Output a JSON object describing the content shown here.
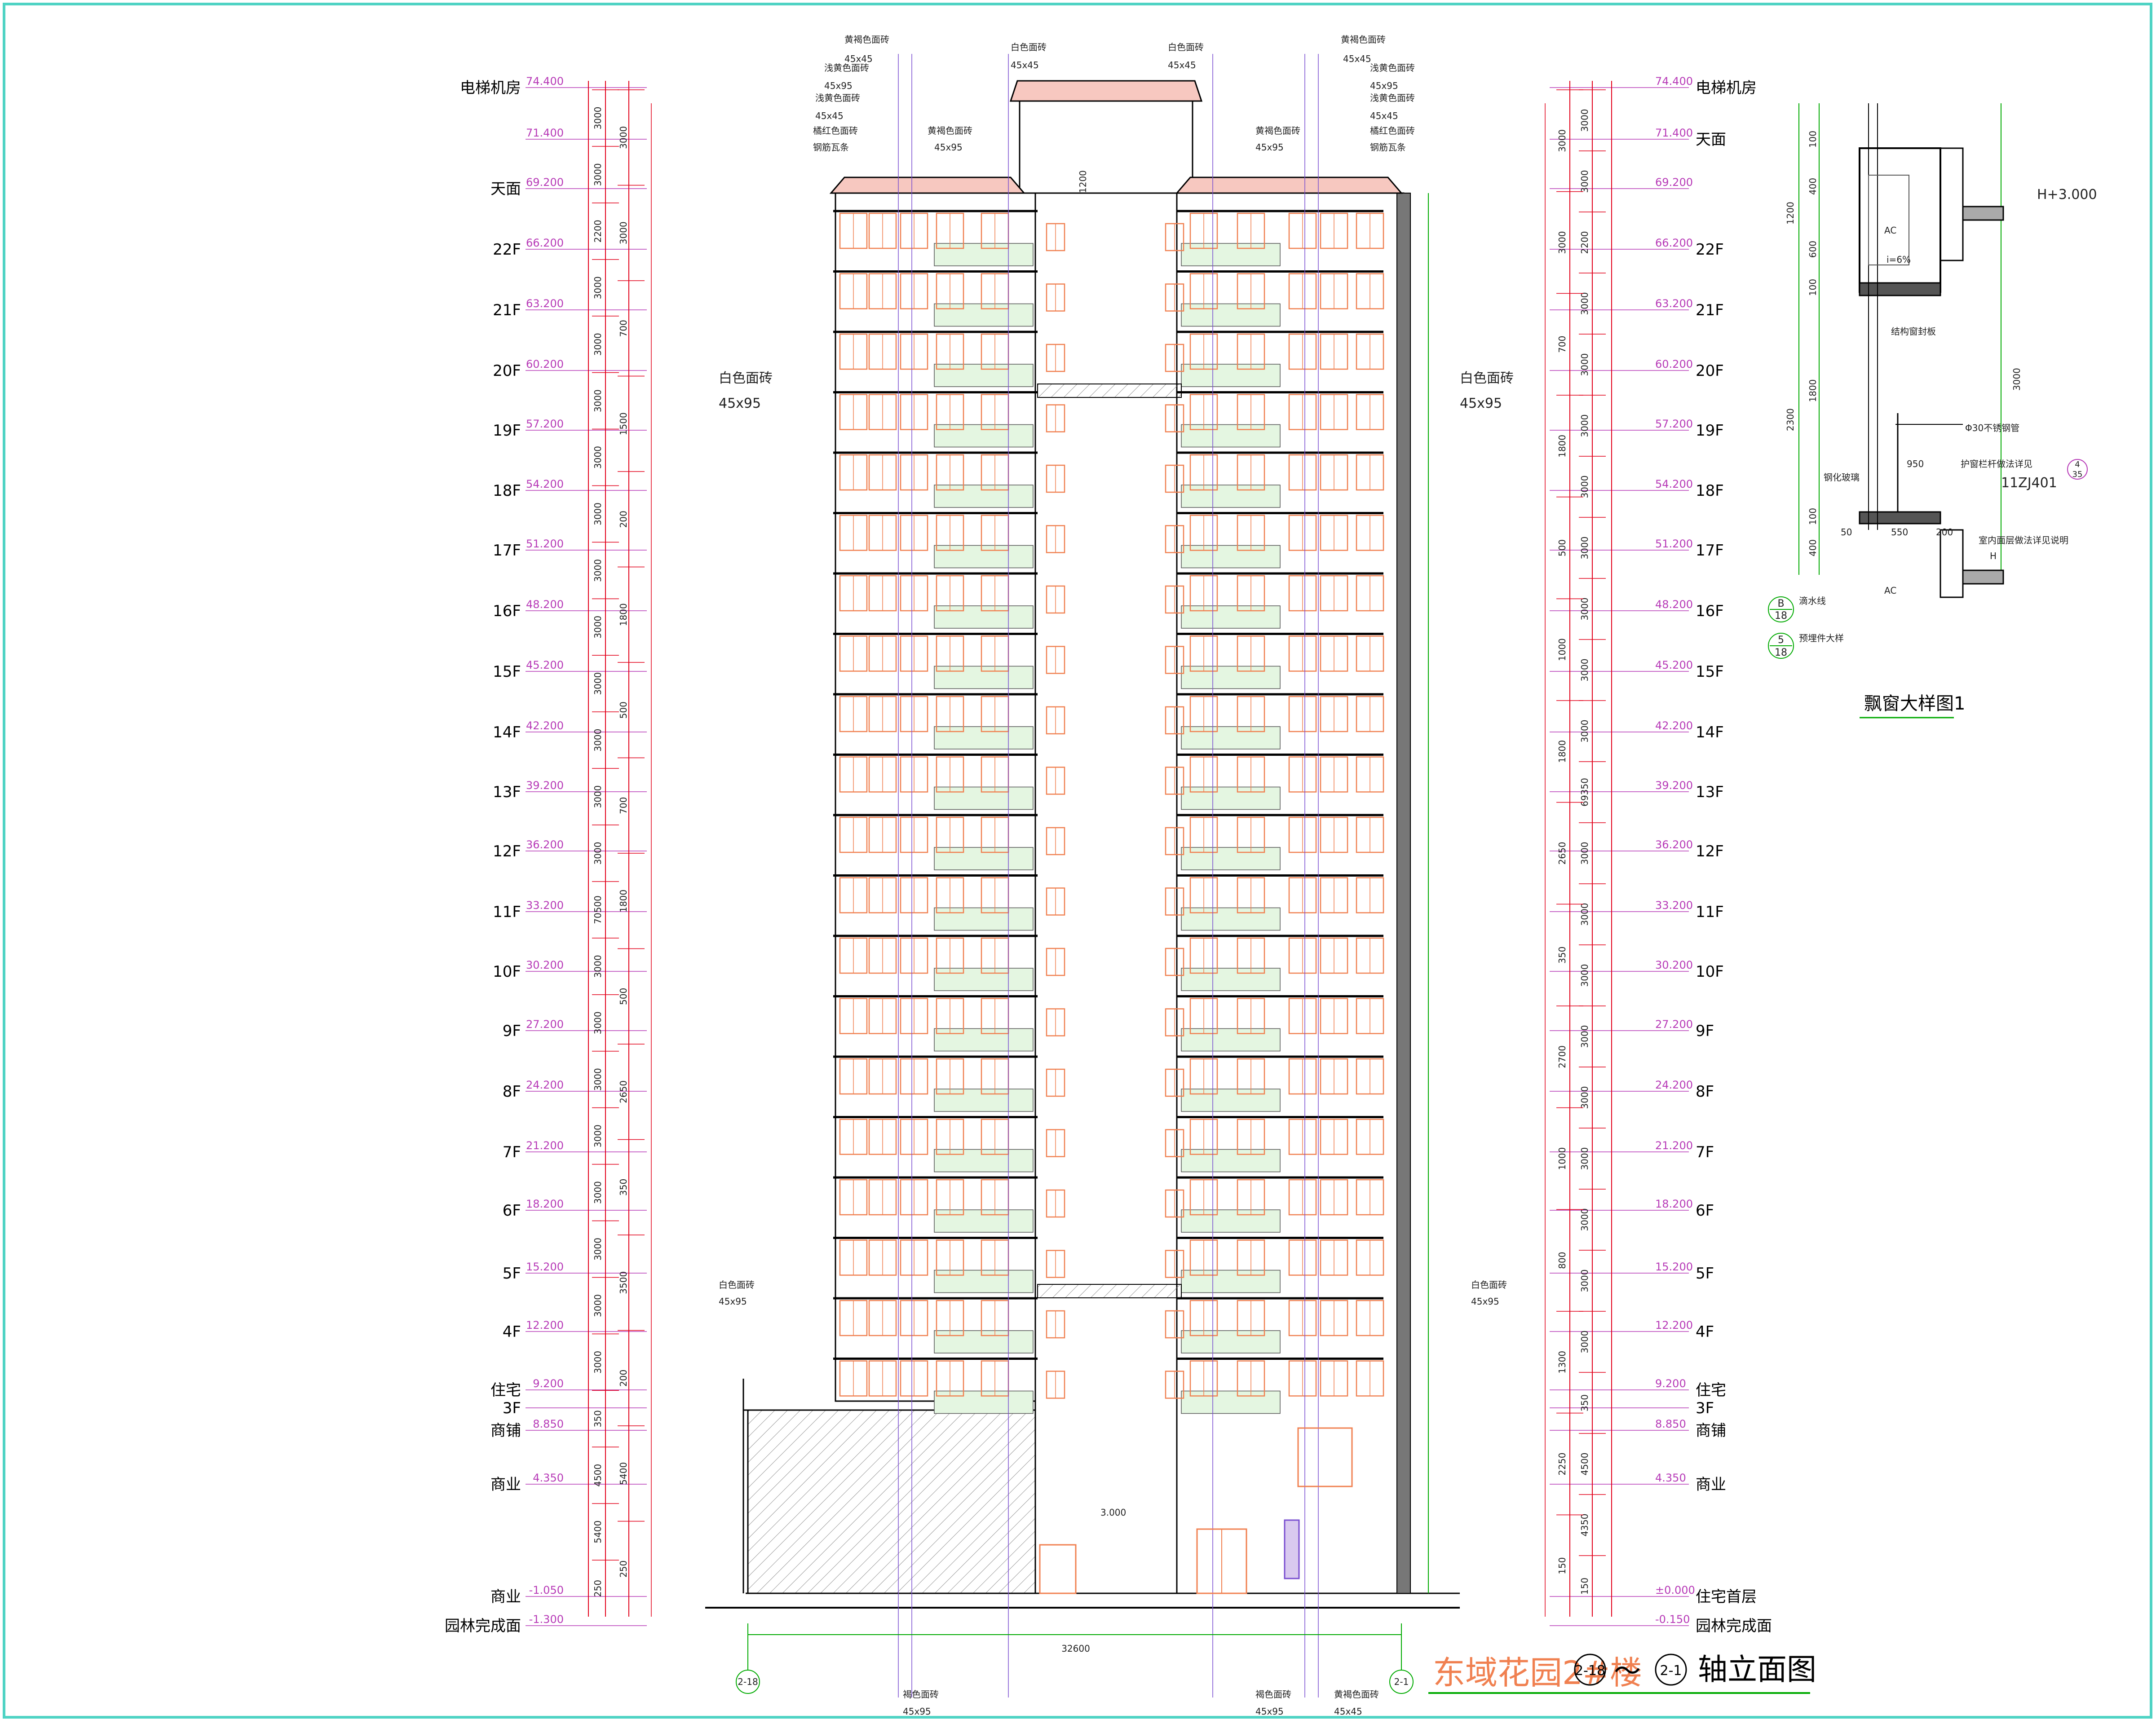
{
  "title": {
    "project": "东域花园2#楼",
    "axis_from": "2-18",
    "connector": "～",
    "axis_to": "2-1",
    "suffix": "轴立面图"
  },
  "left_labels": [
    {
      "name": "电梯机房",
      "elev": "74.400"
    },
    {
      "name": "",
      "elev": "71.400"
    },
    {
      "name": "天面",
      "elev": "69.200"
    },
    {
      "name": "22F",
      "elev": "66.200"
    },
    {
      "name": "21F",
      "elev": "63.200"
    },
    {
      "name": "20F",
      "elev": "60.200"
    },
    {
      "name": "19F",
      "elev": "57.200"
    },
    {
      "name": "18F",
      "elev": "54.200"
    },
    {
      "name": "17F",
      "elev": "51.200"
    },
    {
      "name": "16F",
      "elev": "48.200"
    },
    {
      "name": "15F",
      "elev": "45.200"
    },
    {
      "name": "14F",
      "elev": "42.200"
    },
    {
      "name": "13F",
      "elev": "39.200"
    },
    {
      "name": "12F",
      "elev": "36.200"
    },
    {
      "name": "11F",
      "elev": "33.200"
    },
    {
      "name": "10F",
      "elev": "30.200"
    },
    {
      "name": "9F",
      "elev": "27.200"
    },
    {
      "name": "8F",
      "elev": "24.200"
    },
    {
      "name": "7F",
      "elev": "21.200"
    },
    {
      "name": "6F",
      "elev": "18.200"
    },
    {
      "name": "5F",
      "elev": "15.200"
    },
    {
      "name": "4F",
      "elev": "12.200"
    },
    {
      "name": "住宅",
      "elev": "9.200"
    },
    {
      "name": "3F",
      "elev": ""
    },
    {
      "name": "商铺",
      "elev": "8.850"
    },
    {
      "name": "商业",
      "elev": "4.350"
    },
    {
      "name": "商业",
      "elev": "-1.050"
    },
    {
      "name": "园林完成面",
      "elev": "-1.300"
    }
  ],
  "right_labels": [
    {
      "name": "电梯机房",
      "elev": "74.400"
    },
    {
      "name": "天面",
      "elev": "71.400"
    },
    {
      "name": "",
      "elev": "69.200"
    },
    {
      "name": "22F",
      "elev": "66.200"
    },
    {
      "name": "21F",
      "elev": "63.200"
    },
    {
      "name": "20F",
      "elev": "60.200"
    },
    {
      "name": "19F",
      "elev": "57.200"
    },
    {
      "name": "18F",
      "elev": "54.200"
    },
    {
      "name": "17F",
      "elev": "51.200"
    },
    {
      "name": "16F",
      "elev": "48.200"
    },
    {
      "name": "15F",
      "elev": "45.200"
    },
    {
      "name": "14F",
      "elev": "42.200"
    },
    {
      "name": "13F",
      "elev": "39.200"
    },
    {
      "name": "12F",
      "elev": "36.200"
    },
    {
      "name": "11F",
      "elev": "33.200"
    },
    {
      "name": "10F",
      "elev": "30.200"
    },
    {
      "name": "9F",
      "elev": "27.200"
    },
    {
      "name": "8F",
      "elev": "24.200"
    },
    {
      "name": "7F",
      "elev": "21.200"
    },
    {
      "name": "6F",
      "elev": "18.200"
    },
    {
      "name": "5F",
      "elev": "15.200"
    },
    {
      "name": "4F",
      "elev": "12.200"
    },
    {
      "name": "住宅",
      "elev": "9.200"
    },
    {
      "name": "3F",
      "elev": ""
    },
    {
      "name": "商铺",
      "elev": "8.850"
    },
    {
      "name": "商业",
      "elev": "4.350"
    },
    {
      "name": "住宅首层",
      "elev": "±0.000"
    },
    {
      "name": "园林完成面",
      "elev": "-0.150"
    }
  ],
  "dims_left_outer": [
    "3000",
    "3000",
    "2200",
    "3000",
    "3000",
    "3000",
    "3000",
    "3000",
    "3000",
    "3000",
    "3000",
    "3000",
    "3000",
    "3000",
    "70500",
    "3000",
    "3000",
    "3000",
    "3000",
    "3000",
    "3000",
    "3000",
    "3000",
    "350",
    "4500",
    "5400",
    "250"
  ],
  "dims_left_inner": [
    "3000",
    "3000",
    "700",
    "1500",
    "200",
    "1800",
    "500",
    "700",
    "1800",
    "500",
    "2650",
    "350",
    "3500",
    "200",
    "5400",
    "250"
  ],
  "dims_right_outer": [
    "3000",
    "3000",
    "2200",
    "3000",
    "3000",
    "3000",
    "3000",
    "3000",
    "3000",
    "3000",
    "3000",
    "69350",
    "3000",
    "3000",
    "3000",
    "3000",
    "3000",
    "3000",
    "3000",
    "3000",
    "3000",
    "350",
    "4500",
    "4350",
    "150"
  ],
  "dims_right_inner": [
    "3000",
    "3000",
    "700",
    "1800",
    "500",
    "1000",
    "1800",
    "2650",
    "350",
    "2700",
    "1000",
    "800",
    "1300",
    "2250",
    "150"
  ],
  "material_notes": {
    "top_left_1": "黄褐色面砖",
    "top_left_1_size": "45x45",
    "top_left_2": "浅黄色面砖",
    "top_left_2_size": "45x95",
    "top_left_3": "浅黄色面砖",
    "top_left_3_size": "45x45",
    "top_left_4": "橘红色面砖",
    "top_left_5": "钢筋瓦条",
    "top_mid_left": "黄褐色面砖",
    "top_mid_left_size": "45x95",
    "top_center_1": "白色面砖",
    "top_center_1_size": "45x45",
    "top_center_2": "白色面砖",
    "top_center_2_size": "45x45",
    "top_right_1": "黄褐色面砖",
    "top_right_1_size": "45x45",
    "top_right_2": "浅黄色面砖",
    "top_right_2_size": "45x95",
    "top_right_3": "浅黄色面砖",
    "top_right_3_size": "45x45",
    "top_right_4": "橘红色面砖",
    "top_right_5": "钢筋瓦条",
    "top_mid_right": "黄褐色面砖",
    "top_mid_right_size": "45x95",
    "side_left": "白色面砖",
    "side_left_size": "45x95",
    "side_right": "白色面砖",
    "side_right_size": "45x95",
    "low_left": "白色面砖",
    "low_left_size": "45x95",
    "low_right": "白色面砖",
    "low_right_size": "45x95",
    "bottom_left": "褐色面砖",
    "bottom_left_size": "45x95",
    "bottom_right_1": "褐色面砖",
    "bottom_right_1_size": "45x95",
    "bottom_right_2": "黄褐色面砖",
    "bottom_right_2_size": "45x45",
    "lobby_elev": "3.000",
    "roof_dim": "1200"
  },
  "overall_width": "32600",
  "axis_bubbles": {
    "left": "2-18",
    "right": "2-1"
  },
  "detail": {
    "title": "飘窗大样图1",
    "dims_left_outer": [
      "1200",
      "2300"
    ],
    "dims_left_inner": [
      "100",
      "400",
      "600",
      "100",
      "1800",
      "100",
      "400"
    ],
    "dim_right": "3000",
    "level_mark": "H+3.000",
    "level_mark_low": "H",
    "label_ac_top": "AC",
    "label_slope": "i=6%",
    "label_struct": "结构窗封板",
    "label_pipe": "Φ30不锈钢管",
    "label_rail": "护窗栏杆做法详见",
    "label_glass": "钢化玻璃",
    "label_std": "11ZJ401",
    "label_std_ref_num": "4",
    "label_std_ref_den": "35",
    "label_950": "950",
    "label_50": "50",
    "label_550": "550",
    "label_200": "200",
    "label_floor": "室内面层做法详见说明",
    "label_ac_bottom": "AC",
    "ref1_num": "B",
    "ref1_den": "18",
    "ref1_text": "滴水线",
    "ref2_num": "5",
    "ref2_den": "18",
    "ref2_text": "预埋件大样"
  }
}
